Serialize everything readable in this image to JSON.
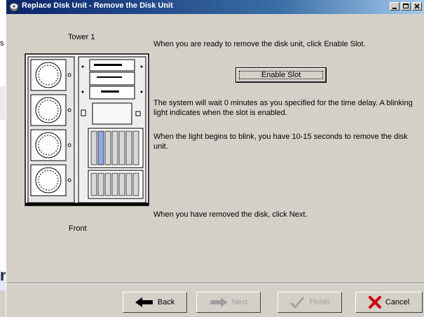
{
  "window": {
    "title": "Replace Disk Unit - Remove the Disk Unit"
  },
  "background": {
    "fragment_char": "s",
    "fragment_big": "n"
  },
  "tower": {
    "label": "Tower 1",
    "view_label": "Front"
  },
  "instructions": {
    "line1": "When you are ready to remove the disk unit, click Enable Slot.",
    "line2": "The system will wait 0 minutes as you specified for the time delay. A blinking light indicates when the slot is enabled.",
    "line3": "When the light begins to blink, you have 10-15 seconds to remove the disk unit.",
    "line4": "When you have removed the disk, click Next."
  },
  "buttons": {
    "enable_slot": "Enable Slot",
    "back": "Back",
    "next": "Next",
    "finish": "Finish",
    "cancel": "Cancel"
  },
  "colors": {
    "titlebar_start": "#0a246a",
    "titlebar_end": "#a6caf0",
    "window_bg": "#d4d0c8",
    "cancel_icon": "#cc0000",
    "disabled_text": "#a0a0a0",
    "highlight_slot": "#8fa8e6"
  },
  "icons": {
    "window": "disk-icon",
    "back": "left-arrow-icon",
    "next": "right-arrow-icon",
    "finish": "checkmark-icon",
    "cancel": "x-icon"
  }
}
